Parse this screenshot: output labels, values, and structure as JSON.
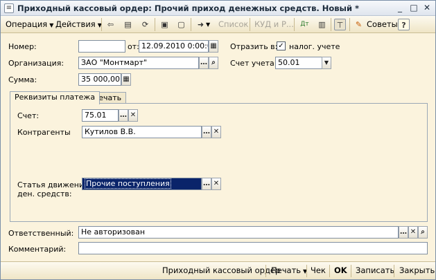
{
  "window": {
    "title": "Приходный кассовый ордер: Прочий приход денежных средств. Новый *",
    "title_icon": "document-icon"
  },
  "toolbar": {
    "operation": "Операция",
    "actions": "Действия",
    "list": "Список",
    "kud": "КУД и Р...",
    "advice": "Советы",
    "help": "?"
  },
  "form": {
    "number_label": "Номер:",
    "number_value": "",
    "date_label": "от:",
    "date_value": "12.09.2010  0:00:0(",
    "reflect_label": "Отразить в:",
    "tax_label": "налог. учете",
    "tax_checked": true,
    "org_label": "Организация:",
    "org_value": "ЗАО \"Монтмарт\"",
    "account_label": "Счет учета:",
    "account_value": "50.01",
    "sum_label": "Сумма:",
    "sum_value": "35 000,00"
  },
  "tabs": [
    "Реквизиты платежа",
    "Печать"
  ],
  "payment": {
    "account_label": "Счет:",
    "account_value": "75.01",
    "counterparty_label": "Контрагенты",
    "counterparty_value": "Кутилов В.В.",
    "cashflow_label_line1": "Статья движения",
    "cashflow_label_line2": "ден. средств:",
    "cashflow_value": "Прочие поступления"
  },
  "footer_fields": {
    "responsible_label": "Ответственный:",
    "responsible_value": "Не авторизован",
    "comment_label": "Комментарий:",
    "comment_value": ""
  },
  "bottom": {
    "print_form": "Приходный кассовый ордер",
    "print": "Печать",
    "check": "Чек",
    "ok": "OK",
    "save": "Записать",
    "close": "Закрыть"
  }
}
